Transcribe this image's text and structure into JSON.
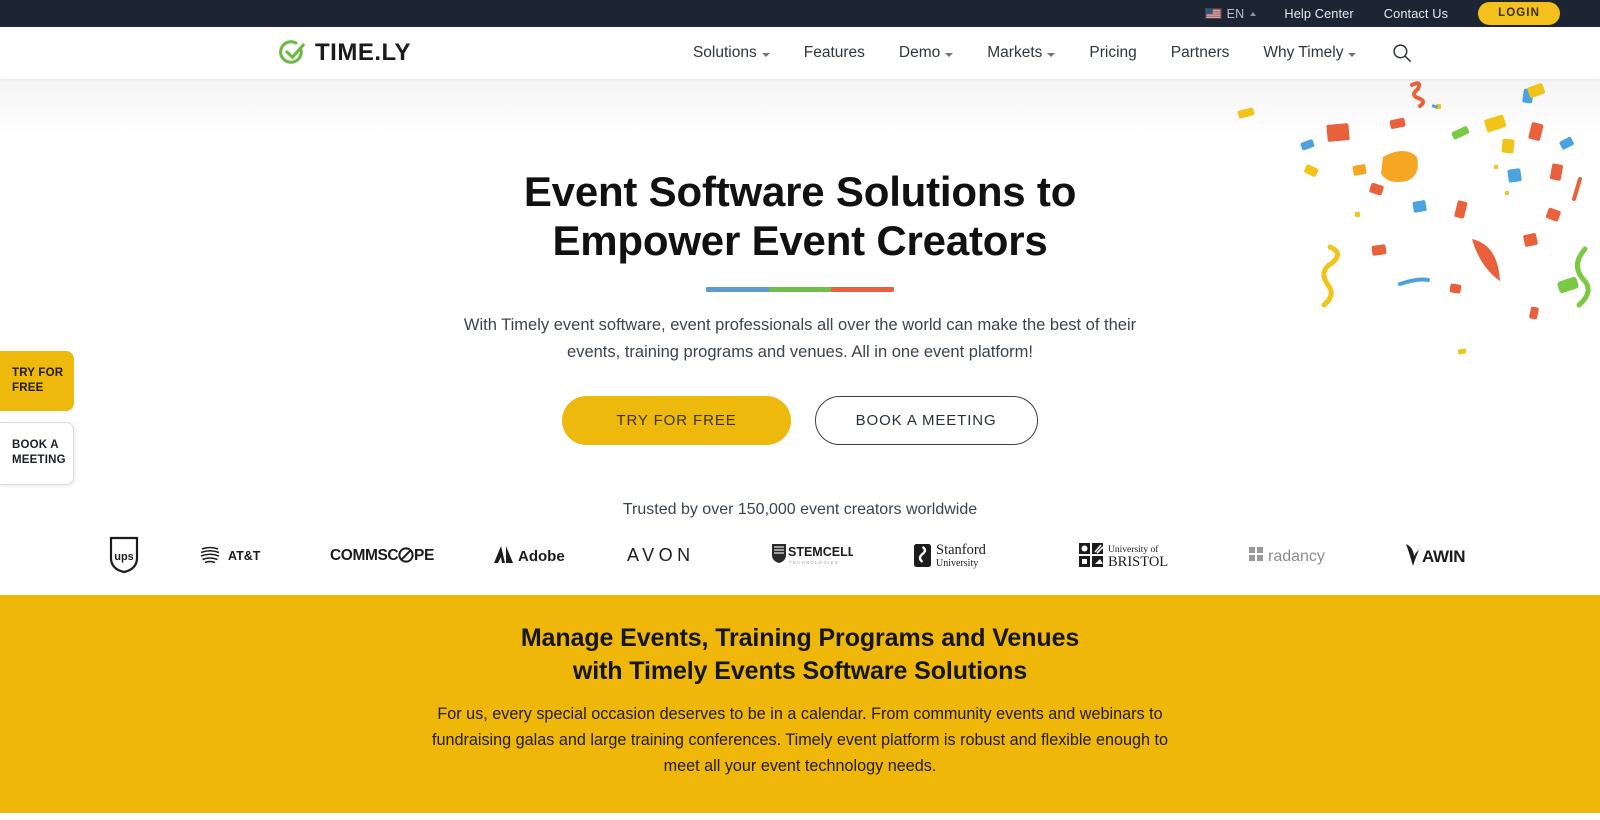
{
  "topbar": {
    "language": {
      "code": "EN",
      "icon": "us-flag-icon"
    },
    "links": [
      {
        "label": "Help Center"
      },
      {
        "label": "Contact Us"
      }
    ],
    "login_label": "LOGIN",
    "login_bg": "#f3c01c",
    "bar_bg": "#1d2433"
  },
  "nav": {
    "brand": "TIME.LY",
    "brand_mark_color": "#6aba43",
    "items": [
      {
        "label": "Solutions",
        "has_dropdown": true
      },
      {
        "label": "Features",
        "has_dropdown": false
      },
      {
        "label": "Demo",
        "has_dropdown": true
      },
      {
        "label": "Markets",
        "has_dropdown": true
      },
      {
        "label": "Pricing",
        "has_dropdown": false
      },
      {
        "label": "Partners",
        "has_dropdown": false
      },
      {
        "label": "Why Timely",
        "has_dropdown": true
      }
    ],
    "search_icon": "search-icon"
  },
  "hero": {
    "title_line1": "Event Software Solutions to",
    "title_line2": "Empower Event Creators",
    "rule_colors": [
      "#5b9bcd",
      "#6ebe4a",
      "#e8613c"
    ],
    "subtitle": "With Timely event software, event professionals all over the world can make the best of their events, training programs and venues. All in one event platform!",
    "primary_cta": "TRY FOR FREE",
    "secondary_cta": "BOOK A MEETING",
    "trusted": "Trusted by over 150,000 event creators worldwide",
    "primary_cta_bg": "#edb90d"
  },
  "side_tabs": [
    {
      "label": "TRY FOR FREE",
      "style": "yellow"
    },
    {
      "label": "BOOK A MEETING",
      "style": "white"
    }
  ],
  "logos": [
    {
      "name": "ups-logo",
      "label": "ups"
    },
    {
      "name": "att-logo",
      "label": "AT&T"
    },
    {
      "name": "commscope-logo",
      "label": "COMMSCOPE"
    },
    {
      "name": "adobe-logo",
      "label": "Adobe"
    },
    {
      "name": "avon-logo",
      "label": "AVON"
    },
    {
      "name": "stemcell-logo",
      "label": "STEMCELL"
    },
    {
      "name": "stanford-logo",
      "label": "Stanford University"
    },
    {
      "name": "bristol-logo",
      "label": "University of BRISTOL"
    },
    {
      "name": "radancy-logo",
      "label": "radancy"
    },
    {
      "name": "awin-logo",
      "label": "AWIN"
    }
  ],
  "yellow_section": {
    "bg": "#efb70a",
    "title_line1": "Manage Events, Training Programs and Venues",
    "title_line2": "with Timely Events Software Solutions",
    "body": "For us, every special occasion deserves to be in a calendar. From community events and webinars to fundraising galas and large training conferences. Timely event platform is robust and flexible enough to meet all your event technology needs."
  }
}
